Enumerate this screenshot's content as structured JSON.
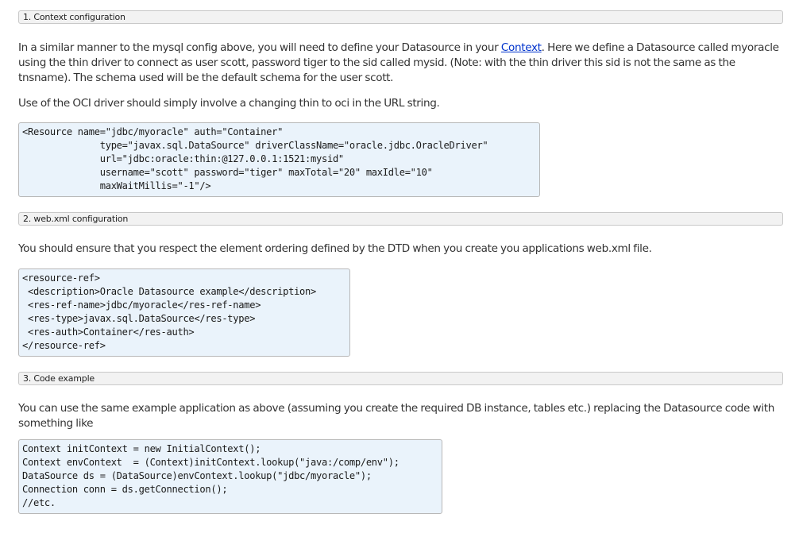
{
  "sections": [
    {
      "header": "1. Context configuration",
      "paragraph1": {
        "before_link": "In a similar manner to the mysql config above, you will need to define your Datasource in your ",
        "link": "Context",
        "after_link": ". Here we define a Datasource called myoracle using the thin driver to connect as user scott, password tiger to the sid called mysid. (Note: with the thin driver this sid is not the same as the tnsname). The schema used will be the default schema for the user scott."
      },
      "paragraph2": "Use of the OCI driver should simply involve a changing thin to oci in the URL string.",
      "code": "<Resource name=\"jdbc/myoracle\" auth=\"Container\"\n              type=\"javax.sql.DataSource\" driverClassName=\"oracle.jdbc.OracleDriver\"\n              url=\"jdbc:oracle:thin:@127.0.0.1:1521:mysid\"\n              username=\"scott\" password=\"tiger\" maxTotal=\"20\" maxIdle=\"10\"\n              maxWaitMillis=\"-1\"/>"
    },
    {
      "header": "2. web.xml configuration",
      "paragraph": "You should ensure that you respect the element ordering defined by the DTD when you create you applications web.xml file.",
      "code": "<resource-ref>\n <description>Oracle Datasource example</description>\n <res-ref-name>jdbc/myoracle</res-ref-name>\n <res-type>javax.sql.DataSource</res-type>\n <res-auth>Container</res-auth>\n</resource-ref>"
    },
    {
      "header": "3. Code example",
      "paragraph": "You can use the same example application as above (assuming you create the required DB instance, tables etc.) replacing the Datasource code with something like",
      "code": "Context initContext = new InitialContext();\nContext envContext  = (Context)initContext.lookup(\"java:/comp/env\");\nDataSource ds = (DataSource)envContext.lookup(\"jdbc/myoracle\");\nConnection conn = ds.getConnection();\n//etc."
    }
  ]
}
